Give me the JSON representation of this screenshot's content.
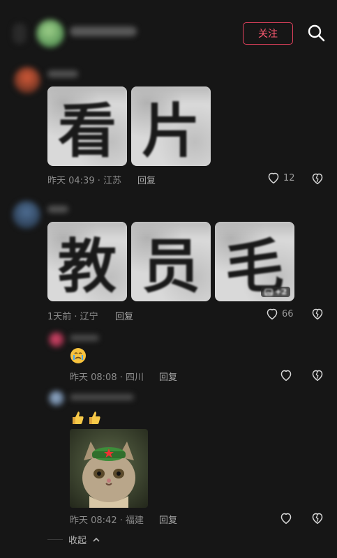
{
  "header": {
    "title": "c***",
    "follow_label": "关注"
  },
  "comments": [
    {
      "user": "用户名",
      "images": [
        "看",
        "片"
      ],
      "time": "昨天 04:39 · 江苏",
      "reply": "回复",
      "likes": "12"
    },
    {
      "user": "用户",
      "images": [
        "教",
        "员",
        "毛"
      ],
      "more_badge": "+2",
      "time": "1天前 · 辽宁",
      "reply": "回复",
      "likes": "66"
    }
  ],
  "replies": [
    {
      "user": "用户",
      "emoji": "crying-face",
      "time": "昨天 08:08 · 四川",
      "reply": "回复"
    },
    {
      "user": "用户名称",
      "emoji": "thumbs-up x2",
      "time": "昨天 08:42 · 福建",
      "reply": "回复"
    }
  ],
  "collapse_label": "收起"
}
